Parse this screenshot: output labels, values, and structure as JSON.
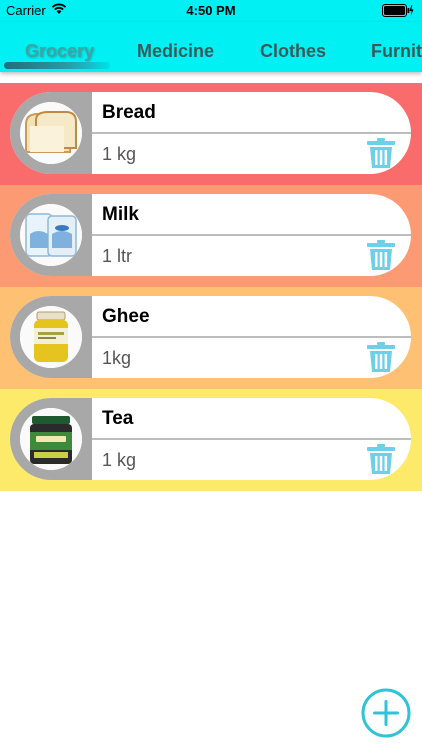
{
  "status_bar": {
    "carrier": "Carrier",
    "time": "4:50 PM"
  },
  "tabs": [
    {
      "label": "Grocery",
      "active": true
    },
    {
      "label": "Medicine",
      "active": false
    },
    {
      "label": "Clothes",
      "active": false
    },
    {
      "label": "Furnit",
      "active": false
    }
  ],
  "items": [
    {
      "name": "Bread",
      "quantity": "1 kg",
      "row_color": "#fa6b6b",
      "image": "bread-image"
    },
    {
      "name": "Milk",
      "quantity": "1 ltr",
      "row_color": "#fc9a73",
      "image": "milk-packets-image"
    },
    {
      "name": "Ghee",
      "quantity": "1kg",
      "row_color": "#fec173",
      "image": "ghee-jar-image"
    },
    {
      "name": "Tea",
      "quantity": "1 kg",
      "row_color": "#fdea6b",
      "image": "tea-jar-image"
    }
  ],
  "colors": {
    "accent": "#00f0f4",
    "trash": "#6cd0e8",
    "fab": "#30c3d8"
  },
  "icons": {
    "trash": "trash-icon",
    "add": "add-circle-icon"
  }
}
